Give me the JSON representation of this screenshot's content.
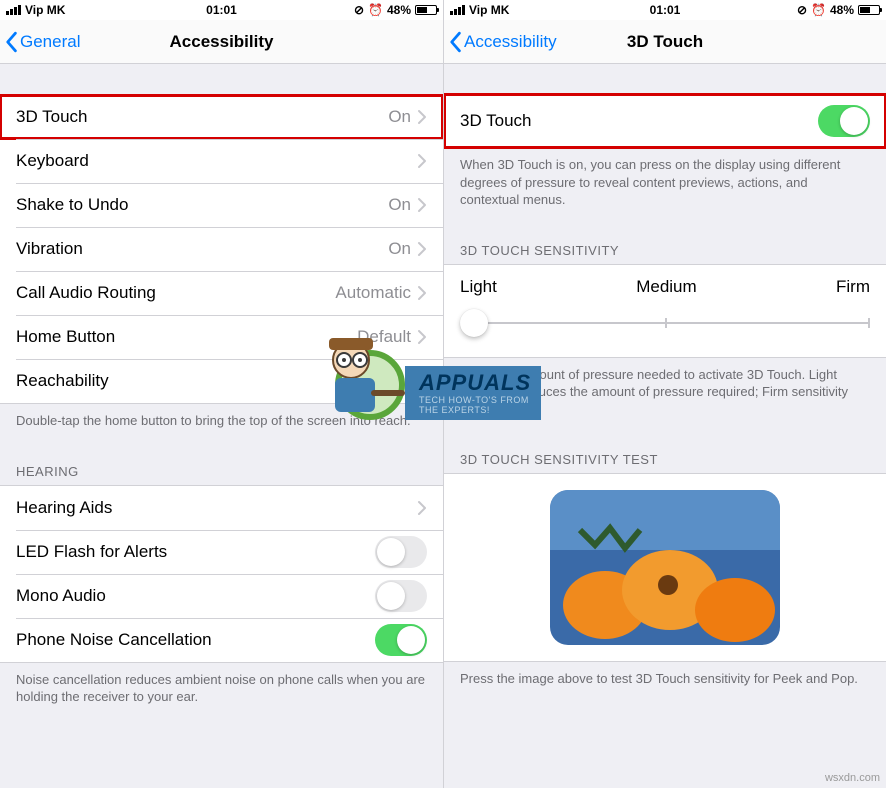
{
  "status": {
    "carrier": "Vip MK",
    "time": "01:01",
    "battery_pct": "48%"
  },
  "left": {
    "back_label": "General",
    "title": "Accessibility",
    "rows": {
      "touch": {
        "label": "3D Touch",
        "value": "On"
      },
      "keyboard": {
        "label": "Keyboard",
        "value": ""
      },
      "shake": {
        "label": "Shake to Undo",
        "value": "On"
      },
      "vibration": {
        "label": "Vibration",
        "value": "On"
      },
      "audio_route": {
        "label": "Call Audio Routing",
        "value": "Automatic"
      },
      "home": {
        "label": "Home Button",
        "value": "Default"
      },
      "reach": {
        "label": "Reachability",
        "value": ""
      }
    },
    "reach_footer": "Double-tap the home button to bring the top of the screen into reach.",
    "hearing_header": "HEARING",
    "hearing": {
      "aids": {
        "label": "Hearing Aids"
      },
      "led": {
        "label": "LED Flash for Alerts"
      },
      "mono": {
        "label": "Mono Audio"
      },
      "noise": {
        "label": "Phone Noise Cancellation"
      }
    },
    "noise_footer": "Noise cancellation reduces ambient noise on phone calls when you are holding the receiver to your ear."
  },
  "right": {
    "back_label": "Accessibility",
    "title": "3D Touch",
    "toggle_label": "3D Touch",
    "toggle_on": true,
    "toggle_footer": "When 3D Touch is on, you can press on the display using different degrees of pressure to reveal content previews, actions, and contextual menus.",
    "sens_header": "3D TOUCH SENSITIVITY",
    "slider": {
      "min_label": "Light",
      "mid_label": "Medium",
      "max_label": "Firm",
      "position_pct": 4
    },
    "sens_footer": "Adjust the amount of pressure needed to activate 3D Touch. Light sensitivity reduces the amount of pressure required; Firm sensitivity increases it.",
    "test_header": "3D TOUCH SENSITIVITY TEST",
    "test_footer": "Press the image above to test 3D Touch sensitivity for Peek and Pop."
  },
  "watermark": {
    "brand": "APPUALS",
    "tag1": "TECH HOW-TO'S FROM",
    "tag2": "THE EXPERTS!"
  },
  "credit": "wsxdn.com"
}
